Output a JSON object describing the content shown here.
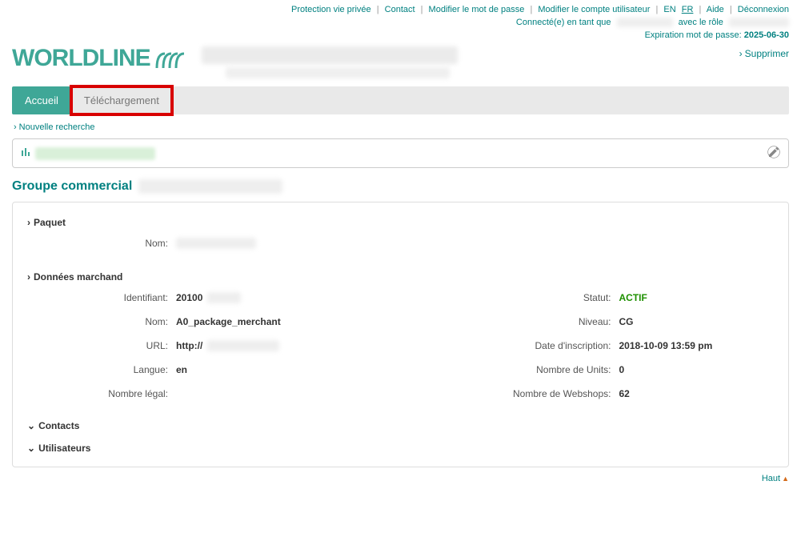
{
  "toplinks": {
    "privacy": "Protection vie privée",
    "contact": "Contact",
    "change_pw": "Modifier le mot de passe",
    "change_user": "Modifier le compte utilisateur",
    "lang_en": "EN",
    "lang_fr": "FR",
    "help": "Aide",
    "logout": "Déconnexion"
  },
  "connected": {
    "prefix": "Connecté(e) en tant que",
    "role_prefix": "avec le rôle"
  },
  "expiry": {
    "label": "Expiration mot de passe:",
    "date": "2025-06-30"
  },
  "logo_text": "WORLDLINE",
  "supprimer_label": "Supprimer",
  "tabs": {
    "accueil": "Accueil",
    "telechargement": "Téléchargement"
  },
  "new_search": "Nouvelle recherche",
  "page_header": "Groupe commercial",
  "sections": {
    "paquet": "Paquet",
    "marchand": "Données marchand",
    "contacts": "Contacts",
    "users": "Utilisateurs"
  },
  "paquet": {
    "nom_label": "Nom:"
  },
  "marchand_left": {
    "id_label": "Identifiant:",
    "id_value": "20100",
    "nom_label": "Nom:",
    "nom_value": "A0_package_merchant",
    "url_label": "URL:",
    "url_value": "http://",
    "lang_label": "Langue:",
    "lang_value": "en",
    "legal_label": "Nombre légal:"
  },
  "marchand_right": {
    "status_label": "Statut:",
    "status_value": "ACTIF",
    "level_label": "Niveau:",
    "level_value": "CG",
    "reg_label": "Date d'inscription:",
    "reg_value": "2018-10-09 13:59 pm",
    "units_label": "Nombre de Units:",
    "units_value": "0",
    "webshops_label": "Nombre de Webshops:",
    "webshops_value": "62"
  },
  "footer_top": "Haut"
}
